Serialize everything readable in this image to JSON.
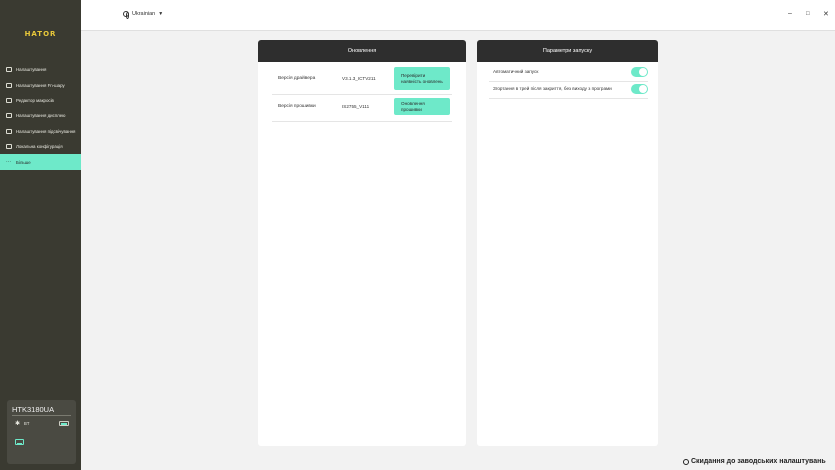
{
  "sidebar": {
    "logo": "HATOR",
    "items": [
      {
        "label": "Налаштування"
      },
      {
        "label": "Налаштування Fn-шару"
      },
      {
        "label": "Редактор макросів"
      },
      {
        "label": "Налаштування дисплею"
      },
      {
        "label": "Налаштування підсвічування"
      },
      {
        "label": "Локальна конфігурація"
      },
      {
        "label": "Більше"
      }
    ],
    "active_item": "Більше",
    "device": {
      "name": "HTK3180UA",
      "connection": "BT"
    }
  },
  "topbar": {
    "language": "Ukrainian"
  },
  "updates_panel": {
    "title": "Оновлення",
    "rows": [
      {
        "label": "Версія драйвера",
        "value": "V3.1.3_ICTV211",
        "button": "Перевірити наявність оновлень"
      },
      {
        "label": "Версія прошивки",
        "value": "IS2755_V111",
        "button": "Оновлення прошивки"
      }
    ]
  },
  "startup_panel": {
    "title": "Параметри запуску",
    "options": [
      {
        "label": "Автоматичний запуск",
        "enabled": true
      },
      {
        "label": "Згортання в трей після закриття, без виходу з програми",
        "enabled": true
      }
    ]
  },
  "footer": {
    "reset_label": "Скидання до заводських налаштувань"
  },
  "colors": {
    "accent": "#6ee9c9",
    "sidebar_bg": "#3a3a31",
    "header_bg": "#2e2e2e",
    "logo": "#e8c83a"
  }
}
